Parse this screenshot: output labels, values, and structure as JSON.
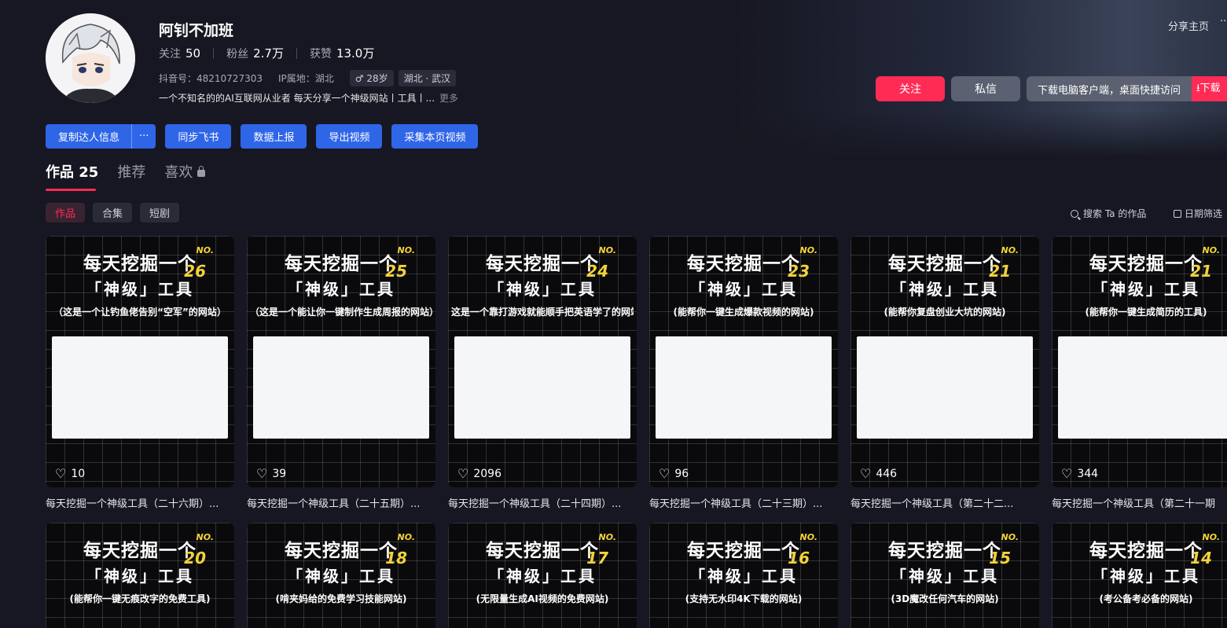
{
  "profile": {
    "name": "阿钊不加班",
    "stats": [
      {
        "label": "关注",
        "value": "50"
      },
      {
        "label": "粉丝",
        "value": "2.7万"
      },
      {
        "label": "获赞",
        "value": "13.0万"
      }
    ],
    "douyin_id": "抖音号：48210727303",
    "ip": "IP属地：湖北",
    "age_tag": "♂ 28岁",
    "location_tag": "湖北 · 武汉",
    "bio": "一个不知名的的AI互联网从业者 每天分享一个神级网站丨工具丨...",
    "bio_more": "更多"
  },
  "header": {
    "share": "分享主页",
    "more": "···",
    "follow": "关注",
    "message": "私信",
    "download": "下载电脑客户端，桌面快捷访问",
    "download2": "⭳下载"
  },
  "actions": {
    "copy": "复制达人信息",
    "copy_more": "···",
    "sync": "同步飞书",
    "report": "数据上报",
    "export": "导出视频",
    "collect": "采集本页视频"
  },
  "tabs": {
    "works": "作品 25",
    "recommend": "推荐",
    "likes": "喜欢"
  },
  "subtabs": {
    "works": "作品",
    "collection": "合集",
    "short_drama": "短剧",
    "search": "搜索 Ta 的作品",
    "date_filter": "日期筛选"
  },
  "colors": {
    "accent": "#fe2c55",
    "action_blue": "#2f66e8",
    "number_yellow": "#f3d23a"
  },
  "videos": [
    {
      "headline": "每天挖掘一个",
      "no": "NO.",
      "num": "26",
      "sub": "「神级」工具",
      "caption": "（这是一个让钓鱼佬告别“空军”的网站）",
      "likes": "10",
      "title": "每天挖掘一个神级工具（二十六期）..."
    },
    {
      "headline": "每天挖掘一个",
      "no": "NO.",
      "num": "25",
      "sub": "「神级」工具",
      "caption": "（这是一个能让你一键制作生成周报的网站）",
      "likes": "39",
      "title": "每天挖掘一个神级工具（二十五期）..."
    },
    {
      "headline": "每天挖掘一个",
      "no": "NO.",
      "num": "24",
      "sub": "「神级」工具",
      "caption": "这是一个靠打游戏就能顺手把英语学了的网站",
      "likes": "2096",
      "title": "每天挖掘一个神级工具（二十四期）..."
    },
    {
      "headline": "每天挖掘一个",
      "no": "NO.",
      "num": "23",
      "sub": "「神级」工具",
      "caption": "(能帮你一键生成爆款视频的网站)",
      "likes": "96",
      "title": "每天挖掘一个神级工具（二十三期）..."
    },
    {
      "headline": "每天挖掘一个",
      "no": "NO.",
      "num": "21",
      "sub": "「神级」工具",
      "caption": "(能帮你复盘创业大坑的网站)",
      "likes": "446",
      "title": "每天挖掘一个神级工具（第二十二..."
    },
    {
      "headline": "每天挖掘一个",
      "no": "NO.",
      "num": "21",
      "sub": "「神级」工具",
      "caption": "(能帮你一键生成简历的工具)",
      "likes": "344",
      "title": "每天挖掘一个神级工具（第二十一期"
    }
  ],
  "videos_row2": [
    {
      "headline": "每天挖掘一个",
      "no": "NO.",
      "num": "20",
      "sub": "「神级」工具",
      "caption": "(能帮你一键无痕改字的免费工具)"
    },
    {
      "headline": "每天挖掘一个",
      "no": "NO.",
      "num": "18",
      "sub": "「神级」工具",
      "caption": "(啃夹妈给的免费学习技能网站)"
    },
    {
      "headline": "每天挖掘一个",
      "no": "NO.",
      "num": "17",
      "sub": "「神级」工具",
      "caption": "(无限量生成AI视频的免费网站)"
    },
    {
      "headline": "每天挖掘一个",
      "no": "NO.",
      "num": "16",
      "sub": "「神级」工具",
      "caption": "(支持无水印4K下载的网站)"
    },
    {
      "headline": "每天挖掘一个",
      "no": "NO.",
      "num": "15",
      "sub": "「神级」工具",
      "caption": "(3D魔改任何汽车的网站)"
    },
    {
      "headline": "每天挖掘一个",
      "no": "NO.",
      "num": "14",
      "sub": "「神级」工具",
      "caption": "(考公备考必备的网站)"
    }
  ]
}
